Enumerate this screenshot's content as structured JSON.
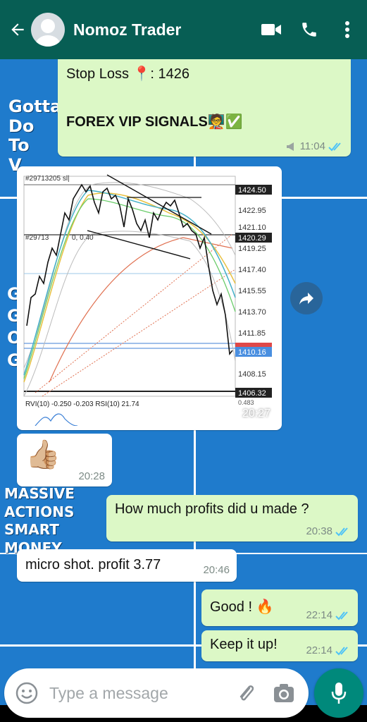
{
  "header": {
    "contact_name": "Nomoz Trader",
    "back_icon": "arrow-left-icon",
    "video_icon": "video-call-icon",
    "call_icon": "phone-icon",
    "menu_icon": "more-vert-icon",
    "color": "#075e54"
  },
  "wallpaper": {
    "text_top": [
      "Gotta",
      "Do",
      "To",
      "V"
    ],
    "text_mid": [
      "G",
      "G",
      "O",
      "G"
    ],
    "text_bottom": [
      "MASSIVE",
      "ACTIONS",
      "SMART",
      "MONEY"
    ],
    "color": "#1f7bcc"
  },
  "messages": [
    {
      "id": "m1",
      "direction": "outgoing",
      "line1": "Stop Loss 📍: 1426",
      "line2": "FOREX VIP SIGNALS🧑‍🏫✅",
      "time": "11:04",
      "status": "read",
      "has_megaphone": true
    },
    {
      "id": "m2",
      "direction": "outgoing",
      "type": "image",
      "time": "20:27"
    },
    {
      "id": "m3",
      "direction": "incoming",
      "text": "👍🏼",
      "time": "20:28"
    },
    {
      "id": "m4",
      "direction": "outgoing",
      "text": "How much profits did u made ?",
      "time": "20:38",
      "status": "read"
    },
    {
      "id": "m5",
      "direction": "incoming",
      "text": "micro shot. profit 3.77",
      "time": "20:46"
    },
    {
      "id": "m6",
      "direction": "outgoing",
      "text": "Good ! 🔥",
      "time": "22:14",
      "status": "read"
    },
    {
      "id": "m7",
      "direction": "outgoing",
      "text": "Keep it up!",
      "time": "22:14",
      "status": "read"
    }
  ],
  "chart_screenshot": {
    "order_label_top": "#29713205 sl|",
    "order_label_mid": "#29713",
    "order_label_mid_value": "0, 0.40",
    "price_labels": [
      "1424.50",
      "1422.95",
      "1421.10",
      "1420.29",
      "1419.25",
      "1417.40",
      "1415.55",
      "1413.70",
      "1411.85",
      "1410.16",
      "1408.15",
      "1406.32"
    ],
    "indicator_label": "RVI(10) -0.250 -0.203 RSI(10) 21.74",
    "indicator_value_small": "0.483"
  },
  "input": {
    "placeholder": "Type a message",
    "emoji_icon": "emoji-icon",
    "attach_icon": "paperclip-icon",
    "camera_icon": "camera-icon",
    "mic_icon": "microphone-icon"
  },
  "forward_icon": "forward-arrow-icon",
  "colors": {
    "outgoing_bubble": "#dcf8c6",
    "incoming_bubble": "#ffffff",
    "read_tick": "#4fc3f7",
    "mic_button": "#00897b"
  }
}
